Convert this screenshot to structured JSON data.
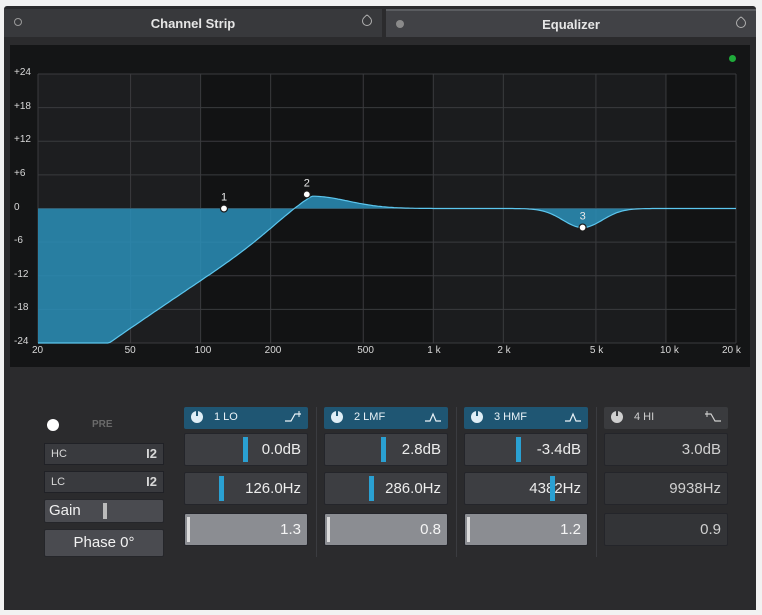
{
  "tabs": {
    "left": "Channel Strip",
    "right": "Equalizer"
  },
  "graph": {
    "db_labels": [
      "+24",
      "+18",
      "+12",
      "+6",
      "0",
      "-6",
      "-12",
      "-18",
      "-24"
    ],
    "freq_labels": [
      "20",
      "50",
      "100",
      "200",
      "500",
      "1 k",
      "2 k",
      "5 k",
      "10 k",
      "20 k"
    ],
    "nodes": [
      {
        "label": "1",
        "freq_hz": 126,
        "gain_db": 0.0
      },
      {
        "label": "2",
        "freq_hz": 286,
        "gain_db": 2.8
      },
      {
        "label": "3",
        "freq_hz": 4382,
        "gain_db": -3.4
      }
    ],
    "accent": "#2a8fb8"
  },
  "left_controls": {
    "pre_label": "PRE",
    "hc_label": "HC",
    "hc_value": "I2",
    "lc_label": "LC",
    "lc_value": "I2",
    "gain_label": "Gain",
    "phase_label": "Phase 0°"
  },
  "bands": [
    {
      "name": "1 LO",
      "gain": "0.0dB",
      "freq": "126.0Hz",
      "q": "1.3",
      "active": true
    },
    {
      "name": "2 LMF",
      "gain": "2.8dB",
      "freq": "286.0Hz",
      "q": "0.8",
      "active": true
    },
    {
      "name": "3 HMF",
      "gain": "-3.4dB",
      "freq": "4382Hz",
      "q": "1.2",
      "active": true
    },
    {
      "name": "4 HI",
      "gain": "3.0dB",
      "freq": "9938Hz",
      "q": "0.9",
      "active": false
    }
  ]
}
